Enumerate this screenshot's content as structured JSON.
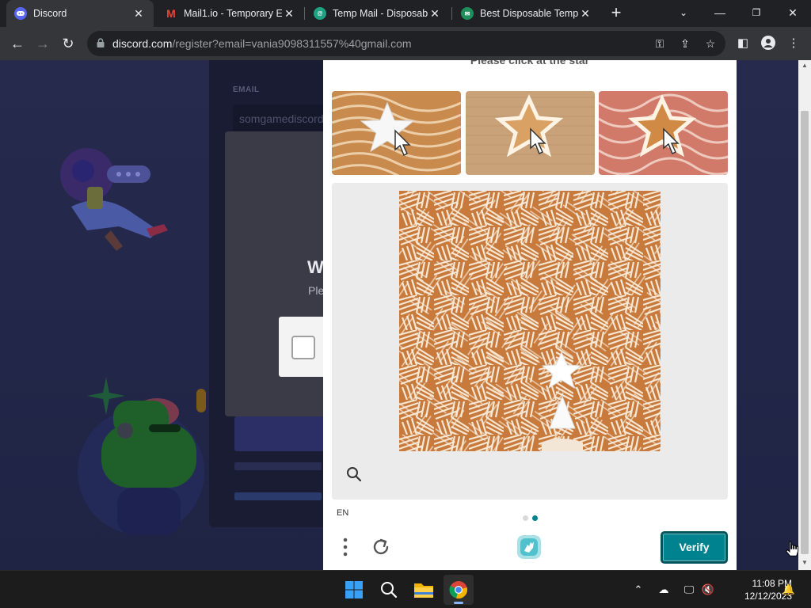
{
  "browser": {
    "tabs": [
      {
        "title": "Discord",
        "favicon": "discord-icon",
        "active": true
      },
      {
        "title": "Mail1.io - Temporary E",
        "favicon": "gmail-icon",
        "active": false
      },
      {
        "title": "Temp Mail - Disposab",
        "favicon": "tempmail-icon",
        "active": false
      },
      {
        "title": "Best Disposable Temp",
        "favicon": "disposable-icon",
        "active": false
      }
    ],
    "url_host": "discord.com",
    "url_path": "/register?email=vania9098311557%40gmail.com"
  },
  "registration": {
    "email_label": "EMAIL",
    "email_value": "somgamediscord",
    "modal_title": "W",
    "modal_subtitle": "Ple"
  },
  "captcha": {
    "prompt": "Please click at the star",
    "language": "EN",
    "verify_label": "Verify",
    "page_indicator": {
      "total": 2,
      "current": 2
    },
    "accent_color": "#00838f"
  },
  "taskbar": {
    "time": "11:08 PM",
    "date": "12/12/2023"
  },
  "colors": {
    "page_bg": "#23284a",
    "captcha_bg": "#ffffff",
    "taskbar_bg": "#1c1c1c"
  }
}
